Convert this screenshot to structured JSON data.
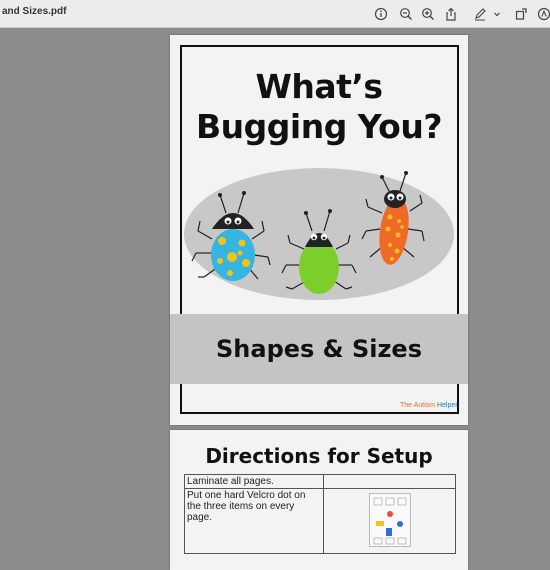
{
  "window": {
    "doc_title": "and Sizes.pdf"
  },
  "toolbar": {
    "icons": [
      "info-icon",
      "zoom-out-icon",
      "zoom-in-icon",
      "share-icon",
      "markup-pen-icon",
      "chevron-down-icon",
      "rotate-icon",
      "search-icon"
    ]
  },
  "cover": {
    "title_line1": "What’s",
    "title_line2": "Bugging You?",
    "banner": "Shapes & Sizes",
    "brand_part1": "The Autism",
    "brand_part2": "Helper."
  },
  "directions": {
    "title": "Directions for Setup",
    "rows": [
      {
        "text": "Laminate all pages."
      },
      {
        "text": "Put one hard Velcro dot on the three items on every page."
      }
    ]
  },
  "colors": {
    "app_background": "#8c8c8c",
    "toolbar": "#ececec",
    "page": "#f3f3f3",
    "banner": "#c4c4c4",
    "oval": "#c8c8c8",
    "bug_blue": "#35b5e0",
    "bug_green": "#7ccf2b",
    "bug_orange": "#f06a27",
    "spot_yellow": "#f4c21a"
  }
}
